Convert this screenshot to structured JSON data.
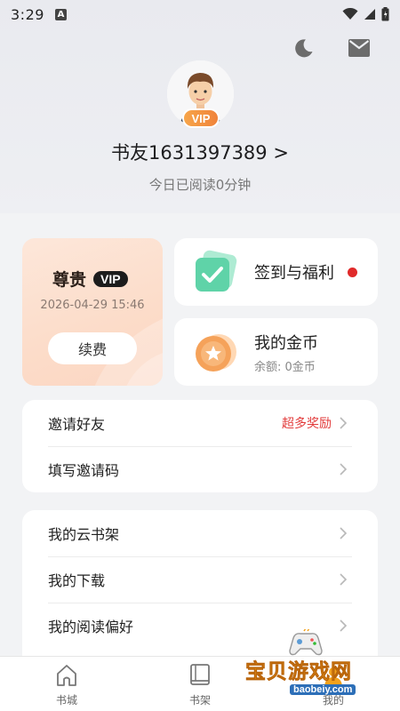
{
  "status_bar": {
    "time": "3:29",
    "notif_icon": "a-letter-icon"
  },
  "header": {
    "night_icon": "moon-icon",
    "message_icon": "mail-icon"
  },
  "profile": {
    "vip_tag": "VIP",
    "username": "书友1631397389 >",
    "read_today": "今日已阅读0分钟"
  },
  "vip_card": {
    "title": "尊贵",
    "badge": "VIP",
    "expire": "2026-04-29 15:46",
    "renew_label": "续费"
  },
  "signin_card": {
    "label": "签到与福利"
  },
  "coins_card": {
    "label": "我的金币",
    "balance": "余额: 0金币"
  },
  "group1": [
    {
      "label": "邀请好友",
      "extra": "超多奖励"
    },
    {
      "label": "填写邀请码",
      "extra": ""
    }
  ],
  "group2": [
    {
      "label": "我的云书架"
    },
    {
      "label": "我的下载"
    },
    {
      "label": "我的阅读偏好"
    }
  ],
  "bottom_nav": [
    {
      "label": "书城",
      "icon": "house-icon"
    },
    {
      "label": "书架",
      "icon": "book-icon"
    },
    {
      "label": "我的",
      "icon": "user-icon"
    }
  ],
  "watermark": {
    "text": "宝贝游戏网",
    "url": "baobeiy.com"
  },
  "colors": {
    "accent_red": "#e23b3b",
    "vip_orange": "#f0833a",
    "signin_green": "#5fd3a8",
    "coin_orange": "#f5a25a"
  }
}
